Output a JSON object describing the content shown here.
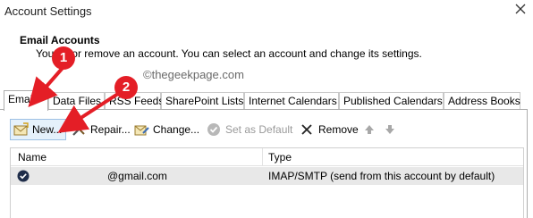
{
  "window": {
    "title": "Account Settings"
  },
  "header": {
    "section_title": "Email Accounts",
    "description": "You     dd or remove an account. You can select an account and change its settings."
  },
  "watermark": "©thegeekpage.com",
  "tabs": [
    {
      "label": "Email",
      "active": true
    },
    {
      "label": "Data Files"
    },
    {
      "label": "RSS Feeds"
    },
    {
      "label": "SharePoint Lists"
    },
    {
      "label": "Internet Calendars"
    },
    {
      "label": "Published Calendars"
    },
    {
      "label": "Address Books"
    }
  ],
  "toolbar": {
    "new_label": "New...",
    "repair_label": "Repair...",
    "change_label": "Change...",
    "set_default_label": "Set as Default",
    "remove_label": "Remove"
  },
  "table": {
    "headers": {
      "name": "Name",
      "type": "Type"
    },
    "rows": [
      {
        "name": "@gmail.com",
        "type": "IMAP/SMTP (send from this account by default)"
      }
    ]
  },
  "annotations": {
    "badge1": "1",
    "badge2": "2"
  },
  "colors": {
    "annotation": "#e41e26",
    "selected_row": "#e8e8e8",
    "new_button_border": "#9dc0e4"
  }
}
